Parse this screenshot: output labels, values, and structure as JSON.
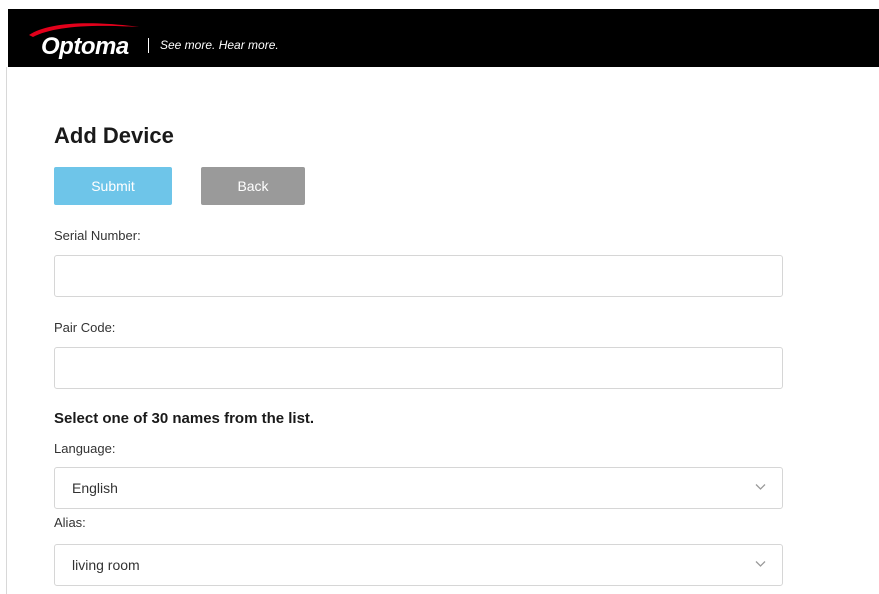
{
  "header": {
    "logo_text": "Optoma",
    "tagline": "See more. Hear more.",
    "colors": {
      "background": "#000000",
      "swoosh": "#e3001b",
      "text": "#ffffff"
    }
  },
  "page": {
    "title": "Add Device"
  },
  "actions": {
    "submit_label": "Submit",
    "back_label": "Back",
    "submit_color": "#6ec5e9",
    "back_color": "#9a9a9a"
  },
  "form": {
    "serial_number": {
      "label": "Serial Number:",
      "value": ""
    },
    "pair_code": {
      "label": "Pair Code:",
      "value": ""
    },
    "names_heading": "Select one of 30 names from the list.",
    "language": {
      "label": "Language:",
      "selected": "English",
      "icon": "chevron-down-icon"
    },
    "alias": {
      "label": "Alias:",
      "selected": "living room",
      "icon": "chevron-down-icon"
    }
  }
}
